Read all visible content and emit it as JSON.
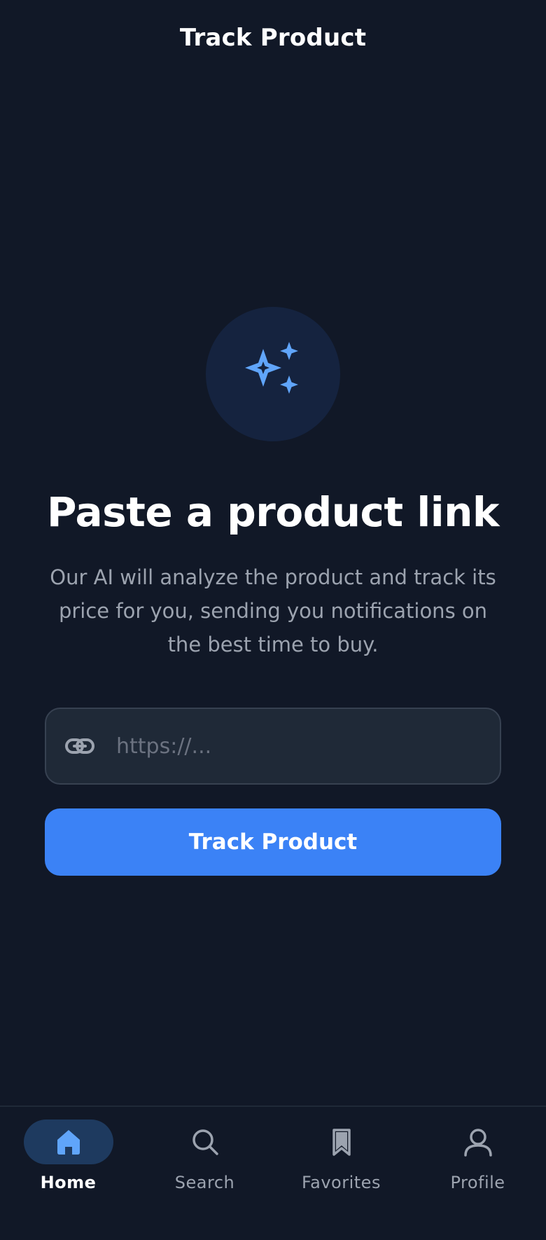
{
  "header": {
    "title": "Track Product"
  },
  "hero": {
    "icon": "sparkles-icon",
    "heading": "Paste a product link",
    "description": "Our AI will analyze the product and track its price for you, sending you notifications on the best time to buy."
  },
  "form": {
    "url_placeholder": "https://...",
    "url_value": "",
    "link_icon": "link-icon",
    "submit_label": "Track Product"
  },
  "bottom_nav": {
    "items": [
      {
        "label": "Home",
        "icon": "home-icon",
        "active": true
      },
      {
        "label": "Search",
        "icon": "search-icon",
        "active": false
      },
      {
        "label": "Favorites",
        "icon": "bookmark-icon",
        "active": false
      },
      {
        "label": "Profile",
        "icon": "user-icon",
        "active": false
      }
    ]
  },
  "colors": {
    "background": "#111827",
    "accent": "#3b82f6",
    "accent_light": "#60a5fa",
    "muted_text": "#9ca3af",
    "input_background": "#1f2937"
  }
}
